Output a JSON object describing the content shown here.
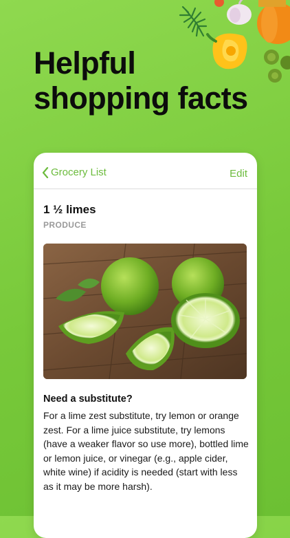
{
  "headline": {
    "line1": "Helpful",
    "line2": "shopping facts"
  },
  "nav": {
    "back_label": "Grocery List",
    "edit_label": "Edit"
  },
  "item": {
    "title": "1 ½ limes",
    "category": "PRODUCE"
  },
  "substitute": {
    "title": "Need a substitute?",
    "body": "For a lime zest substitute, try lemon or orange zest. For a lime juice substitute, try lemons (have a weaker flavor so use more), bottled lime or lemon juice, or vinegar (e.g., apple cider, white wine) if acidity is needed (start with less as it may be more harsh)."
  },
  "colors": {
    "background": "#7fcf42",
    "accent": "#6bbb3c",
    "card": "#ffffff",
    "text": "#111111",
    "muted": "#9a9a9a"
  }
}
